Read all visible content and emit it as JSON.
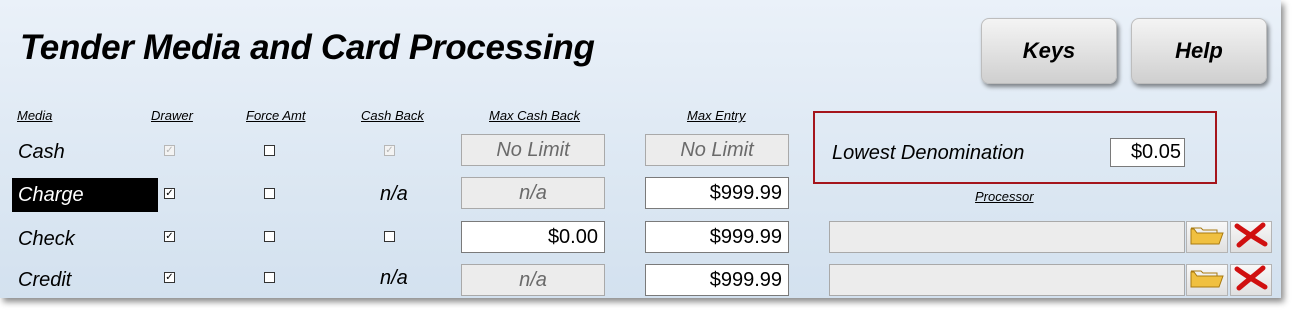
{
  "title": "Tender Media and Card Processing",
  "buttons": {
    "keys": "Keys",
    "help": "Help"
  },
  "columns": {
    "media": "Media",
    "drawer": "Drawer",
    "force_amt": "Force Amt",
    "cash_back": "Cash Back",
    "max_cash_back": "Max Cash Back",
    "max_entry": "Max Entry",
    "processor": "Processor"
  },
  "rows": [
    {
      "media": "Cash",
      "selected": false,
      "drawer": true,
      "drawer_disabled": true,
      "force_amt": false,
      "cash_back": "checked-disabled",
      "max_cash_back": "No Limit",
      "max_entry": "No Limit"
    },
    {
      "media": "Charge",
      "selected": true,
      "drawer": true,
      "drawer_disabled": false,
      "force_amt": false,
      "cash_back": "n/a",
      "max_cash_back": "n/a",
      "max_entry": "$999.99"
    },
    {
      "media": "Check",
      "selected": false,
      "drawer": true,
      "drawer_disabled": false,
      "force_amt": false,
      "cash_back": "unchecked",
      "max_cash_back": "$0.00",
      "max_entry": "$999.99"
    },
    {
      "media": "Credit",
      "selected": false,
      "drawer": true,
      "drawer_disabled": false,
      "force_amt": false,
      "cash_back": "n/a",
      "max_cash_back": "n/a",
      "max_entry": "$999.99"
    }
  ],
  "lowest_denomination": {
    "label": "Lowest Denomination",
    "value": "$0.05"
  },
  "processors": [
    {
      "icons": [
        "folder-icon",
        "delete-x-icon"
      ]
    },
    {
      "icons": [
        "folder-icon",
        "delete-x-icon"
      ]
    }
  ],
  "colors": {
    "highlight_box": "#a5151c",
    "selected_row": "#000000",
    "delete_red": "#d01010",
    "folder_yellow": "#f0c040"
  }
}
